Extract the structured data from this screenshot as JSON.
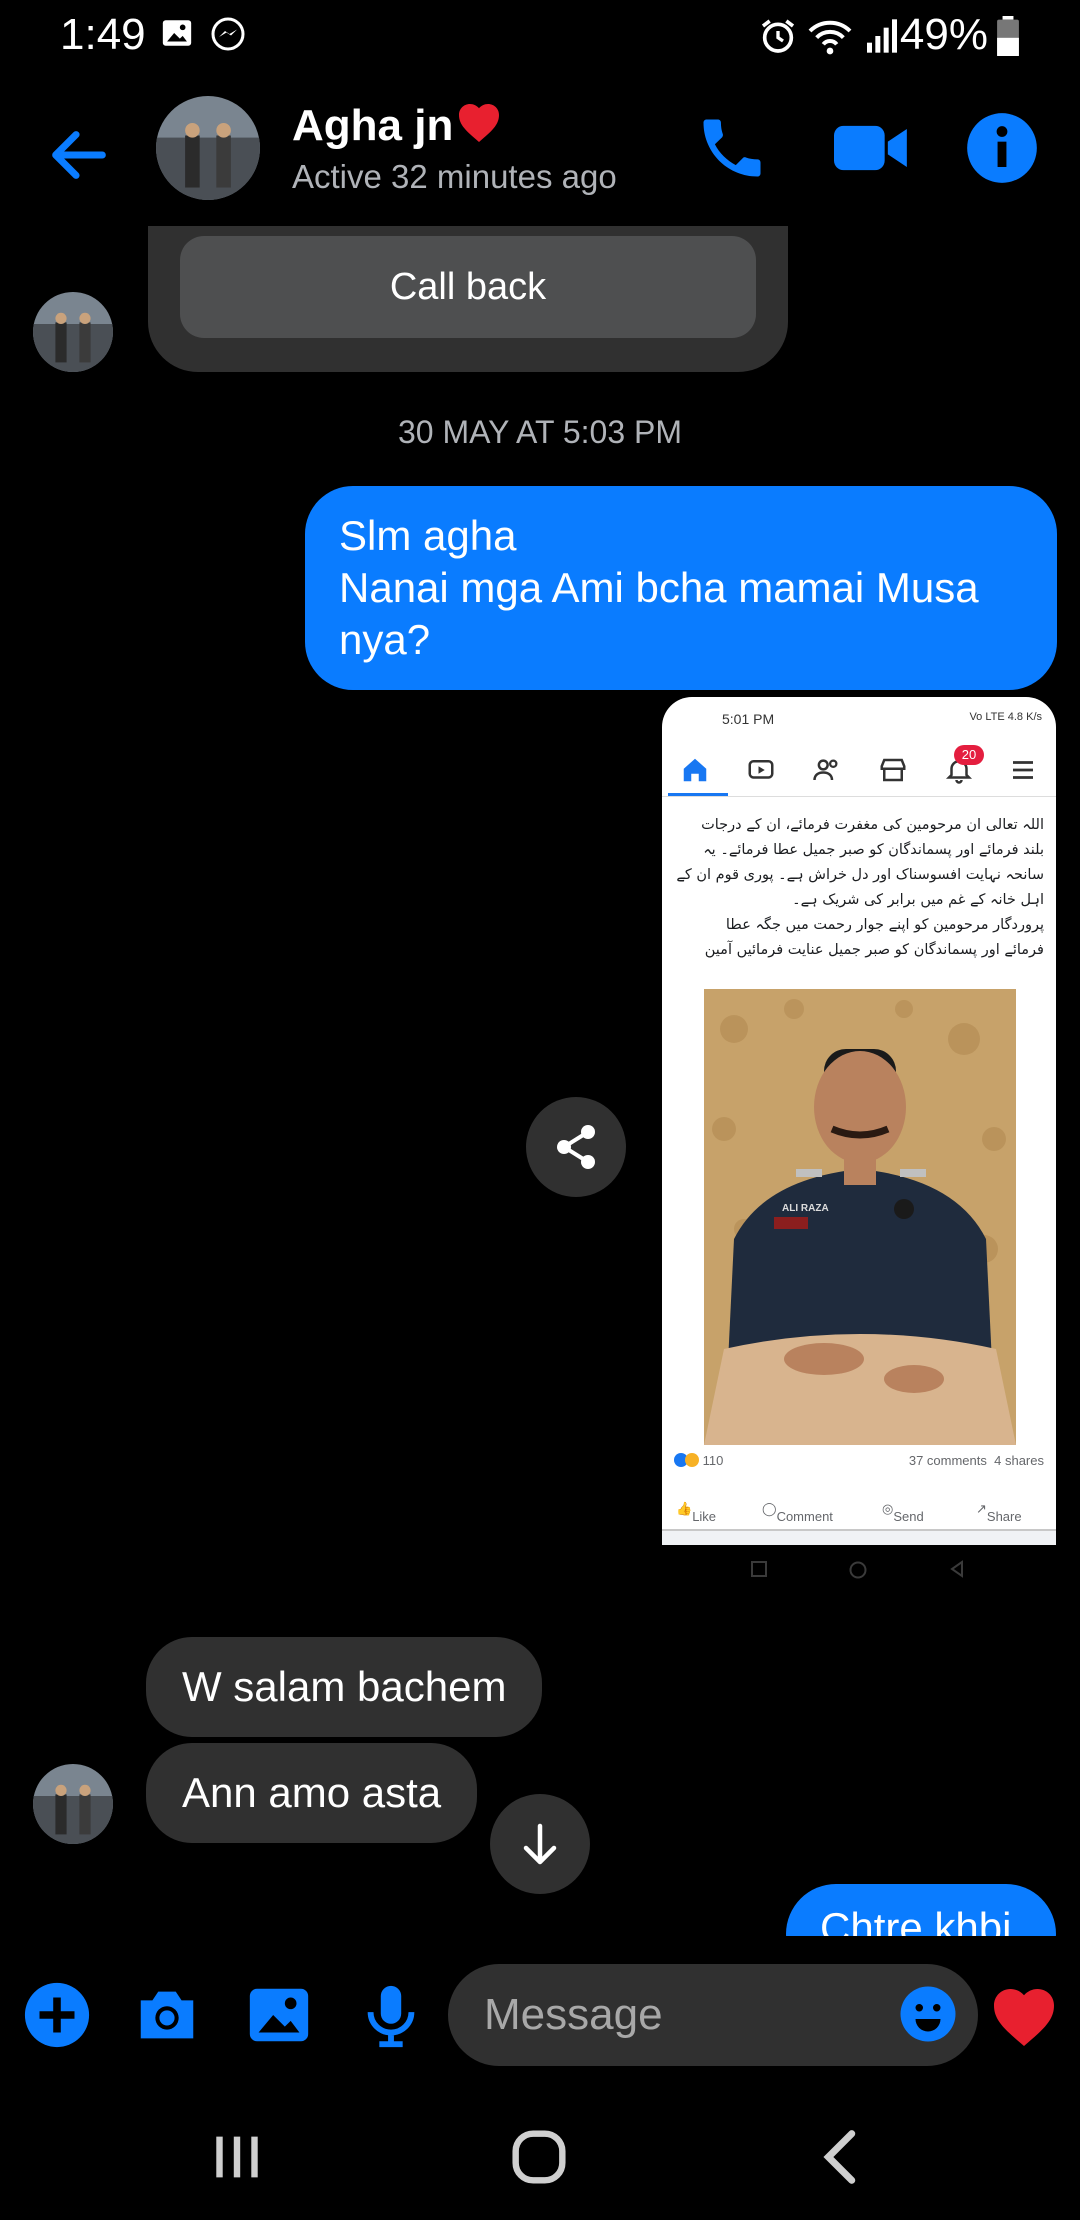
{
  "status_bar": {
    "time": "1:49",
    "battery": "49%",
    "icons": [
      "gallery-icon",
      "messenger-icon",
      "alarm-icon",
      "wifi-icon",
      "signal-icon",
      "battery-icon"
    ]
  },
  "header": {
    "name": "Agha jn",
    "name_emoji": "heart-icon",
    "status": "Active 32 minutes ago",
    "buttons": [
      "phone-icon",
      "video-icon",
      "info-icon"
    ]
  },
  "call_card": {
    "button_label": "Call back"
  },
  "date_separator": "30 MAY AT 5:03 PM",
  "outgoing_message": {
    "lines": [
      "Slm agha",
      "Nanai mga Ami bcha mamai Musa",
      "nya?"
    ]
  },
  "shared_screenshot": {
    "time": "5:01 PM",
    "network": "Vo LTE 4.8 K/s",
    "notification_count": "20",
    "post_text_lines": [
      "اللہ تعالی ان مرحومین کی مغفرت فرمائے، ان کے درجات",
      "بلند فرمائے اور پسماندگان کو صبر جمیل عطا فرمائے۔ یہ",
      "سانحہ نہایت افسوسناک اور دل خراش ہے۔ پوری قوم ان کے",
      "اہل خانہ کے غم میں برابر کی شریک ہے۔",
      "پروردگار مرحومین کو اپنے جوار رحمت میں جگہ عطا",
      "فرمائے اور پسماندگان کو صبر جمیل عنایت فرمائیں آمین"
    ],
    "photo_name_tag": "ALI RAZA",
    "reactions": "110",
    "comments": "37 comments",
    "shares": "4 shares",
    "actions": [
      "Like",
      "Comment",
      "Send",
      "Share"
    ]
  },
  "incoming_messages": [
    "W salam  bachem",
    "Ann amo asta"
  ],
  "partial_outgoing": "Chtre khbi",
  "composer": {
    "placeholder": "Message",
    "icons": [
      "plus-icon",
      "camera-icon",
      "gallery-icon",
      "microphone-icon",
      "emoji-icon",
      "heart-icon"
    ]
  },
  "colors": {
    "accent": "#0a7cff",
    "bubble_in": "#303030",
    "background": "#000000"
  }
}
